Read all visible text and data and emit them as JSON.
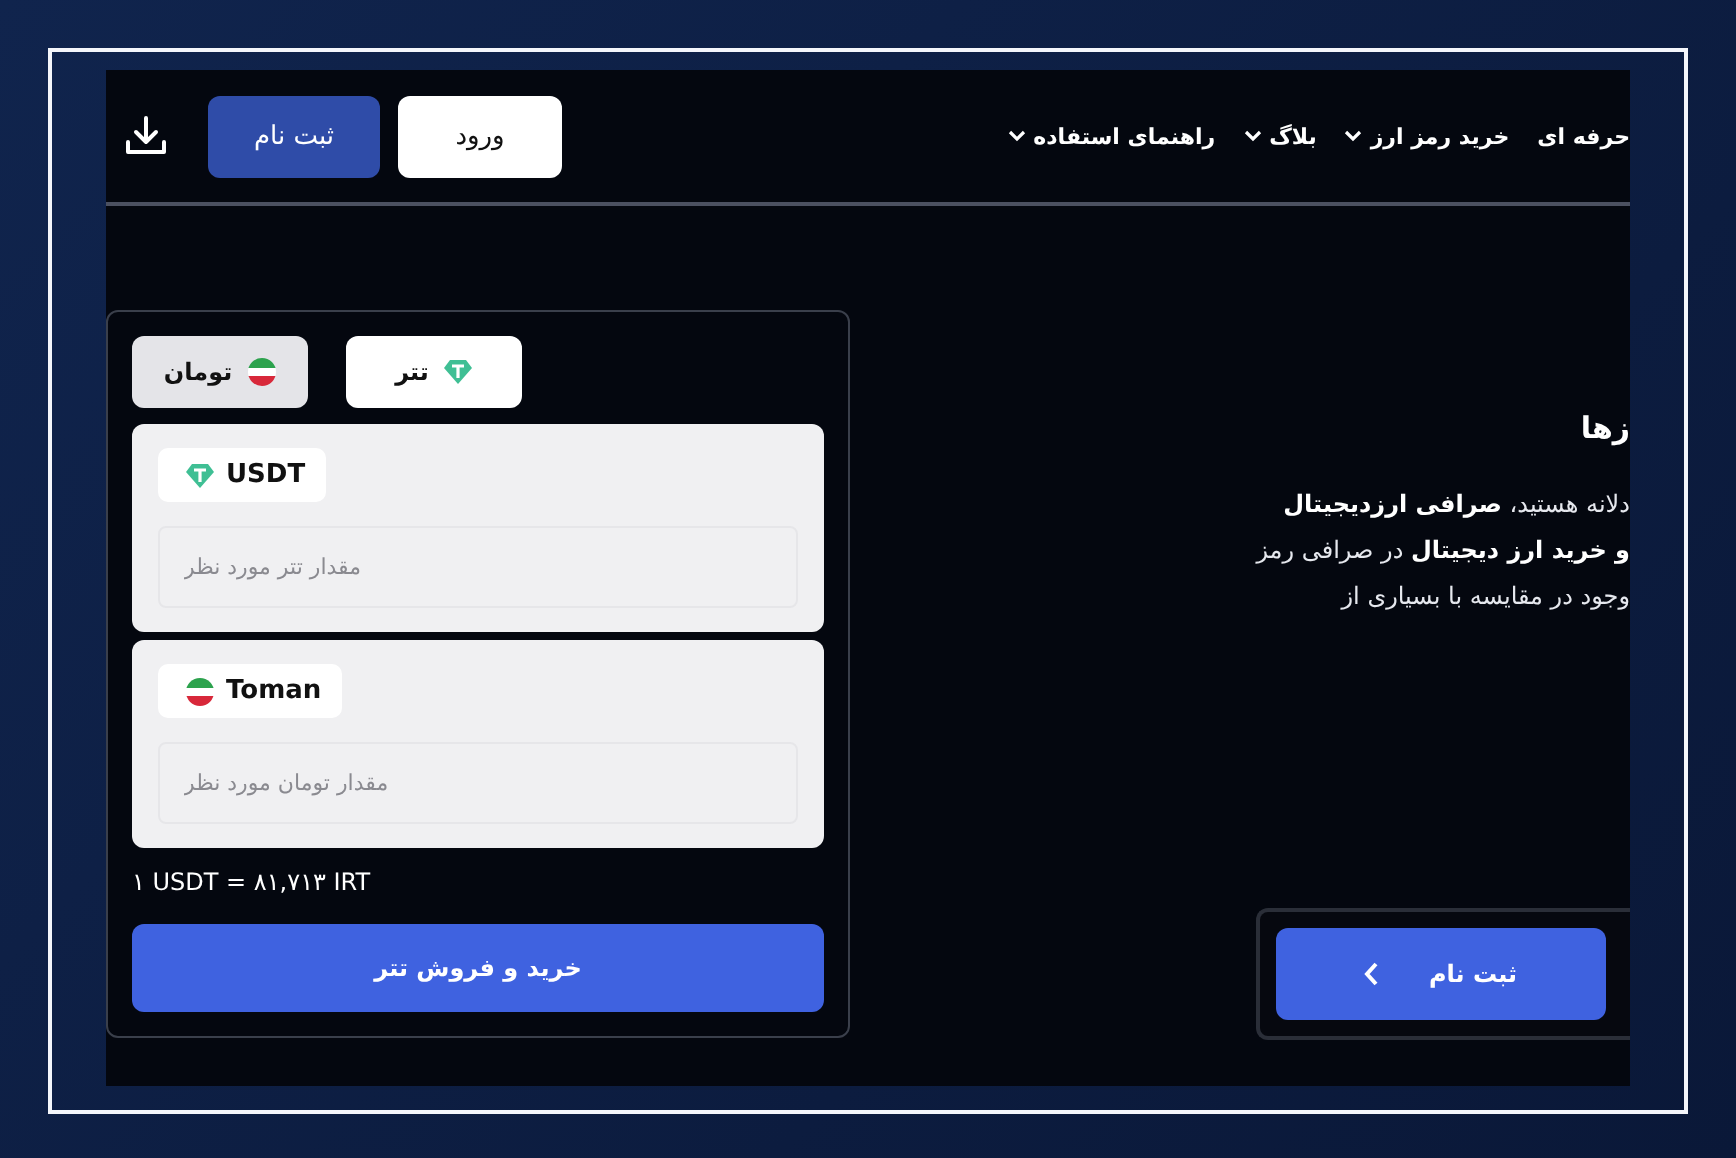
{
  "header": {
    "nav": [
      {
        "label": "حرفه ای",
        "dropdown": false
      },
      {
        "label": "خرید رمز ارز",
        "dropdown": true
      },
      {
        "label": "بلاگ",
        "dropdown": true
      },
      {
        "label": "راهنمای استفاده",
        "dropdown": true
      }
    ],
    "login": "ورود",
    "register": "ثبت نام"
  },
  "converter": {
    "tabs": [
      {
        "label": "تتر",
        "kind": "tether",
        "selected": true
      },
      {
        "label": "تومان",
        "kind": "flag",
        "selected": false
      }
    ],
    "fields": [
      {
        "kind": "tether",
        "code": "USDT",
        "placeholder": "مقدار تتر مورد نظر"
      },
      {
        "kind": "flag",
        "code": "Toman",
        "placeholder": "مقدار تومان مورد نظر"
      }
    ],
    "rate": "۱ USDT = ۸۱,۷۱۳ IRT",
    "submit": "خرید و فروش تتر"
  },
  "intro": {
    "heading": "زها",
    "paragraph": [
      "دلانه هستید، **صرافی ارزدیجیتال**",
      "**و خرید ارز دیجیتال** در صرافی رمز",
      "وجود در مقایسه با بسیاری از"
    ],
    "register": "ثبت نام"
  }
}
